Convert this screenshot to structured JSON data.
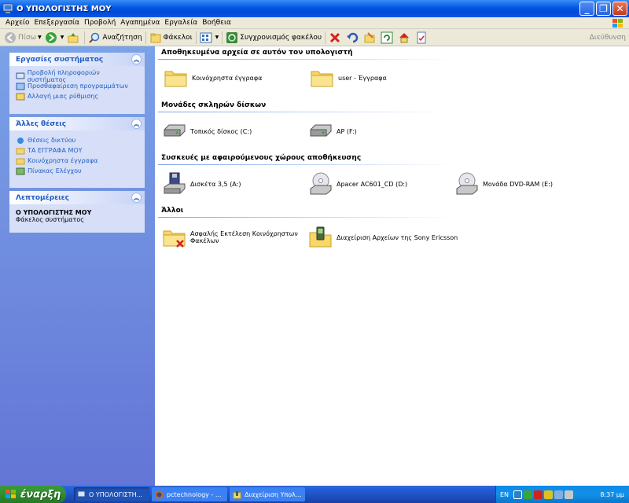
{
  "window": {
    "title": "Ο ΥΠΟΛΟΓΙΣΤΗΣ ΜΟΥ"
  },
  "menu": [
    "Αρχείο",
    "Επεξεργασία",
    "Προβολή",
    "Αγαπημένα",
    "Εργαλεία",
    "Βοήθεια"
  ],
  "toolbar": {
    "back": "Πίσω",
    "search": "Αναζήτηση",
    "folders": "Φάκελοι",
    "sync": "Συγχρονισμός φακέλου",
    "address": "Διεύθυνση"
  },
  "left": {
    "system_tasks": {
      "title": "Εργασίες συστήματος",
      "items": [
        "Προβολή πληροφοριών συστήματος",
        "Προσθαφαίρεση προγραμμάτων",
        "Αλλαγή μιας ρύθμισης"
      ]
    },
    "other_places": {
      "title": "Άλλες θέσεις",
      "items": [
        "Θέσεις δικτύου",
        "ΤΑ ΕΓΓΡΑΦΑ ΜΟΥ",
        "Κοινόχρηστα έγγραφα",
        "Πίνακας Ελέγχου"
      ]
    },
    "details": {
      "title": "Λεπτομέρειες",
      "name": "Ο ΥΠΟΛΟΓΙΣΤΗΣ ΜΟΥ",
      "type": "Φάκελος συστήματος"
    }
  },
  "groups": {
    "stored": {
      "title": "Αποθηκευμένα αρχεία σε αυτόν τον υπολογιστή",
      "items": [
        "Κοινόχρηστα έγγραφα",
        "user - Έγγραφα"
      ]
    },
    "hdd": {
      "title": "Μονάδες σκληρών δίσκων",
      "items": [
        "Τοπικός δίσκος (C:)",
        "AP (F:)"
      ]
    },
    "removable": {
      "title": "Συσκευές με αφαιρούμενους χώρους αποθήκευσης",
      "items": [
        "Δισκέτα 3,5 (A:)",
        "Apacer AC601_CD (D:)",
        "Μονάδα DVD-RAM (E:)"
      ]
    },
    "other": {
      "title": "Άλλοι",
      "items": [
        "Ασφαλής Εκτέλεση Κοινόχρηστων Φακέλων",
        "Διαχείριση Αρχείων της Sony Ericsson"
      ]
    }
  },
  "taskbar": {
    "start": "έναρξη",
    "tasks": [
      "Ο ΥΠΟΛΟΓΙΣΤΗ...",
      "pctechnology - ...",
      "Διαχείριση Υπολ..."
    ],
    "lang": "EN",
    "clock": "8:37 μμ"
  }
}
